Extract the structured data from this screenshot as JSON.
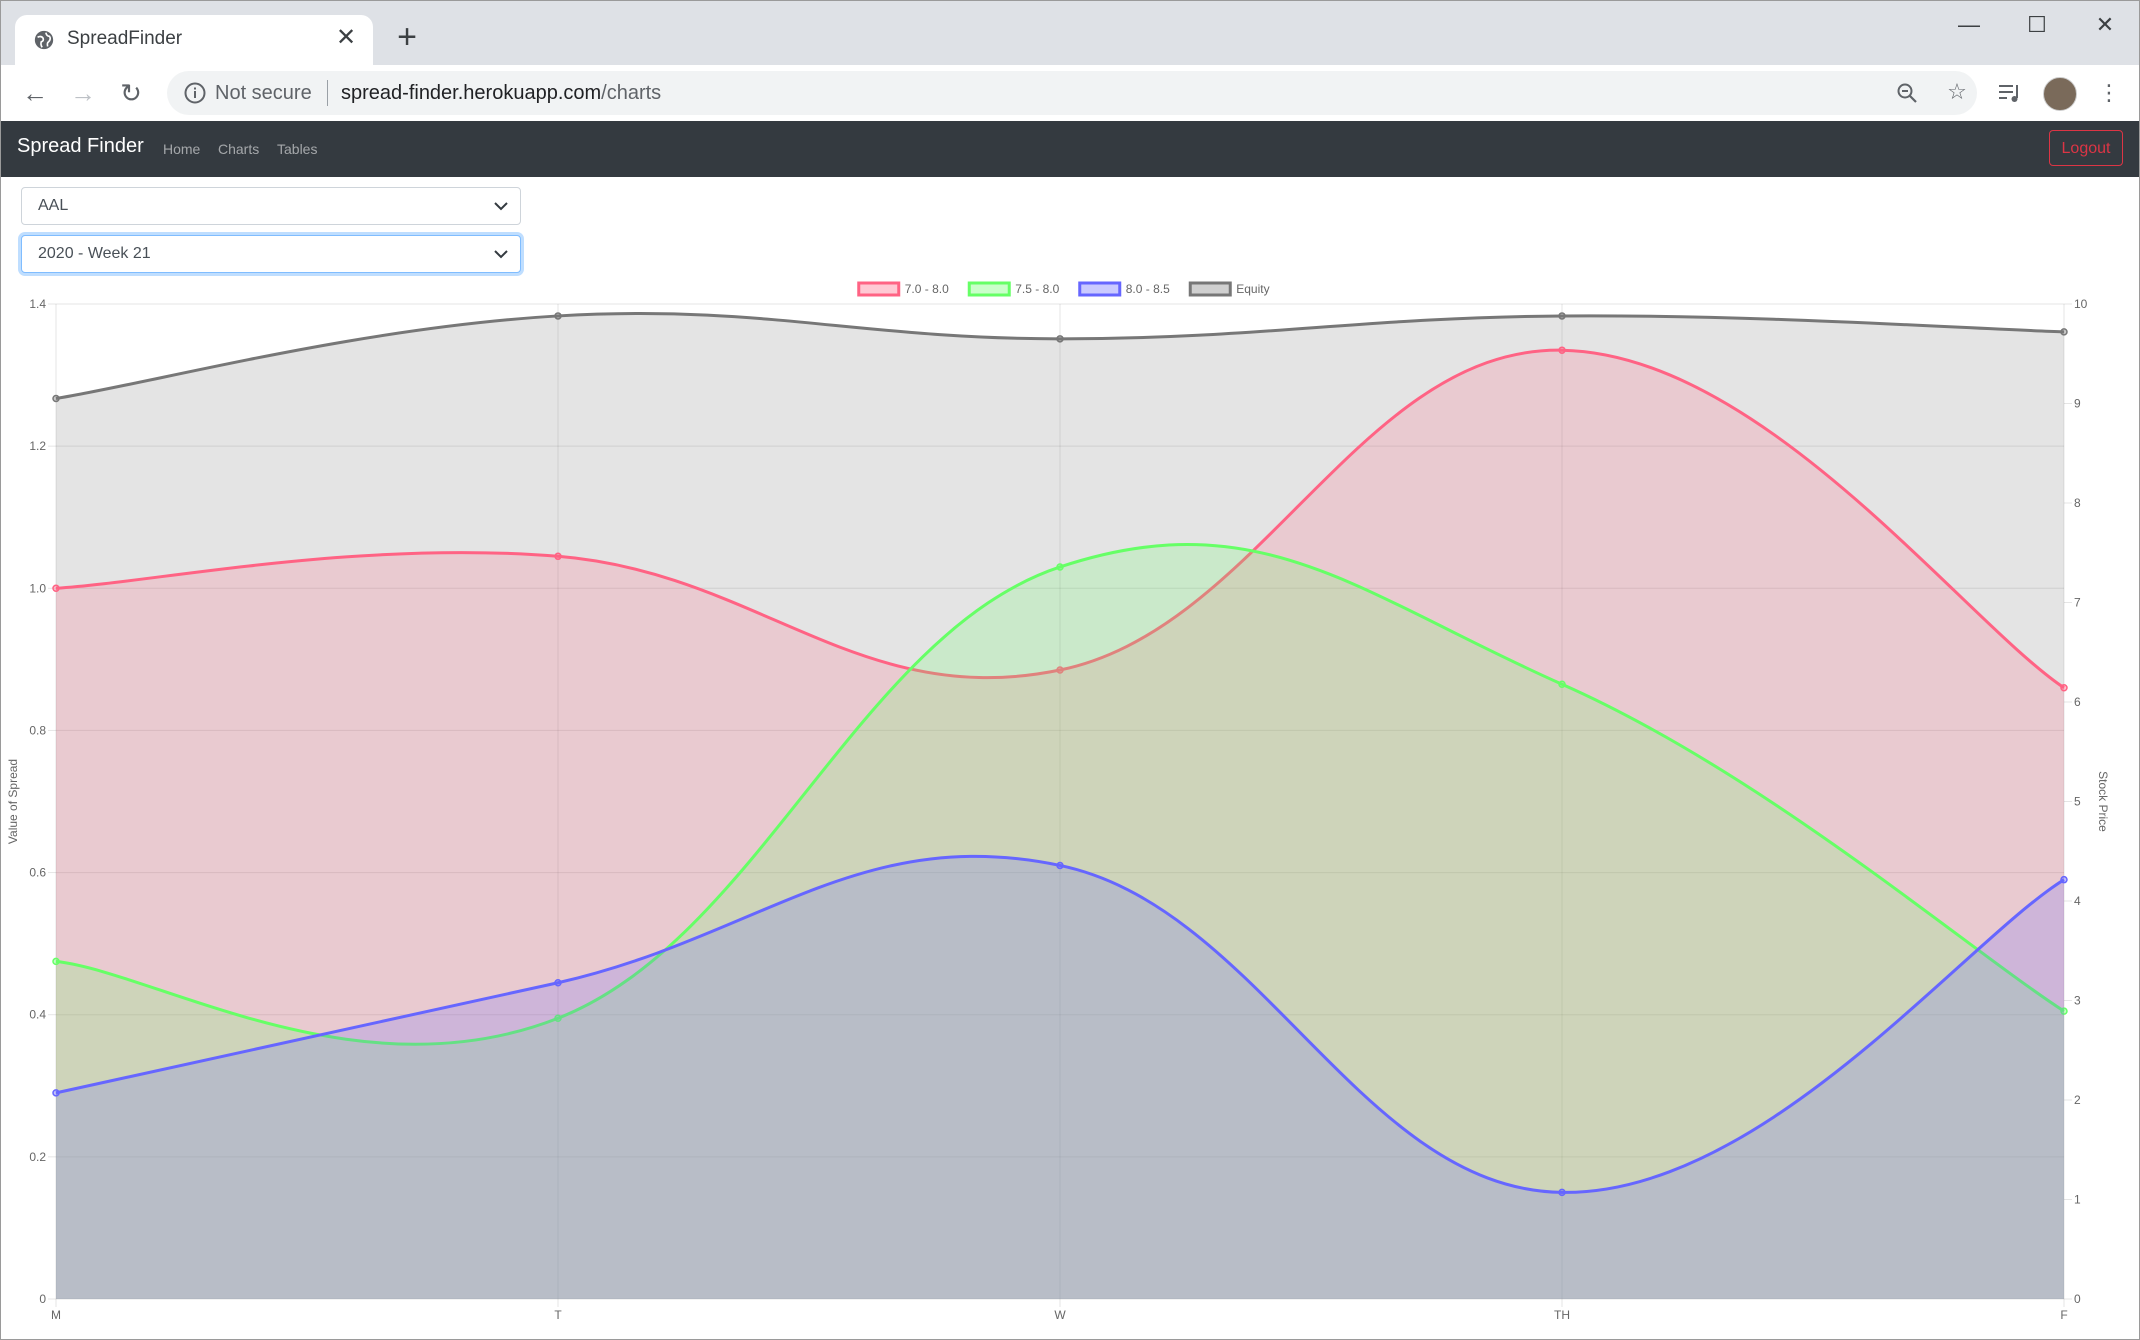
{
  "browser": {
    "tab_title": "SpreadFinder",
    "tab_close": "✕",
    "new_tab": "+",
    "window_controls": [
      "—",
      "☐",
      "✕"
    ],
    "security_label": "Not secure",
    "url_host": "spread-finder.herokuapp.com",
    "url_path": "/charts"
  },
  "navbar": {
    "brand": "Spread Finder",
    "links": [
      "Home",
      "Charts",
      "Tables"
    ],
    "logout": "Logout"
  },
  "filters": {
    "ticker": "AAL",
    "week": "2020 - Week 21"
  },
  "chart_data": {
    "type": "area",
    "categories": [
      "M",
      "T",
      "W",
      "TH",
      "F"
    ],
    "series": [
      {
        "name": "7.0 - 8.0",
        "axis": "left",
        "color": "#ff6384",
        "values": [
          1.0,
          1.045,
          0.885,
          1.335,
          0.86
        ]
      },
      {
        "name": "7.5 - 8.0",
        "axis": "left",
        "color": "#66ff66",
        "values": [
          0.475,
          0.395,
          1.03,
          0.865,
          0.405
        ]
      },
      {
        "name": "8.0 - 8.5",
        "axis": "left",
        "color": "#6666ff",
        "values": [
          0.29,
          0.445,
          0.61,
          0.15,
          0.59
        ]
      },
      {
        "name": "Equity",
        "axis": "right",
        "color": "#777777",
        "values": [
          9.05,
          9.88,
          9.65,
          9.88,
          9.72
        ]
      }
    ],
    "ylabel": "Value of Spread",
    "y2label": "Stock Price",
    "ylim": [
      0,
      1.4
    ],
    "y2lim": [
      0,
      10
    ],
    "yticks": [
      "0",
      "0.2",
      "0.4",
      "0.6",
      "0.8",
      "1.0",
      "1.2",
      "1.4"
    ],
    "y2ticks": [
      "0",
      "1",
      "2",
      "3",
      "4",
      "5",
      "6",
      "7",
      "8",
      "9",
      "10"
    ],
    "legend": "top-center",
    "grid": true
  }
}
